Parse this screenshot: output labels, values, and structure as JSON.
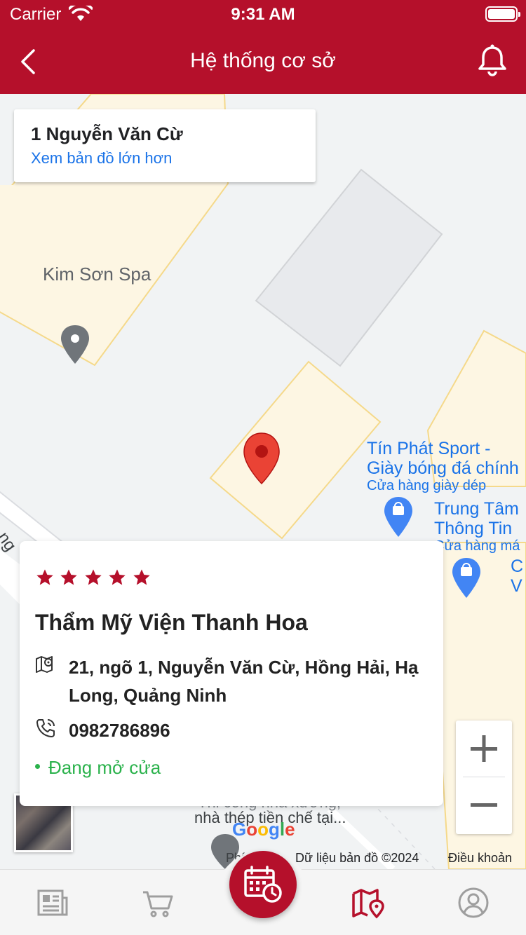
{
  "status_bar": {
    "carrier": "Carrier",
    "time": "9:31 AM"
  },
  "header": {
    "title": "Hệ thống cơ sở",
    "back_icon": "chevron-left-icon",
    "notification_icon": "bell-icon"
  },
  "map": {
    "place_card": {
      "name": "1 Nguyễn Văn Cừ",
      "link": "Xem bản đồ lớn hơn"
    },
    "pois": [
      {
        "label": "Kim Sơn Spa"
      },
      {
        "label_line1": "Tín Phát Sport -",
        "label_line2": "Giày bóng đá chính",
        "category": "Cửa hàng giày dép"
      },
      {
        "label_line1": "Trung Tâm",
        "label_line2": "Thông Tin",
        "category": "Cửa hàng má"
      },
      {
        "label_line1": "C",
        "label_line2": "V"
      }
    ],
    "road_fragment": "ng",
    "below_card_line1": "Thi công nhà xưởng,",
    "below_card_line2": "nhà thép tiền chế tại...",
    "bottom_left_text": "Phí",
    "google_logo": "Google",
    "map_data": "Dữ liệu bản đồ ©2024",
    "terms": "Điều khoản",
    "zoom_in": "+",
    "zoom_out": "−"
  },
  "business": {
    "rating": 5,
    "name": "Thẩm Mỹ Viện Thanh Hoa",
    "address_line1": "21, ngõ 1, Nguyễn Văn Cừ, Hồng Hải, Hạ",
    "address_line2": "Long, Quảng Ninh",
    "phone": "0982786896",
    "status": "Đang mở cửa"
  },
  "colors": {
    "brand": "#b5102b",
    "open_green": "#2bb24c",
    "map_link": "#1a73e8"
  },
  "bottom_nav": {
    "items": [
      "news-icon",
      "cart-icon",
      "booking-calendar-icon",
      "map-icon",
      "profile-icon"
    ],
    "active": "map-icon"
  }
}
